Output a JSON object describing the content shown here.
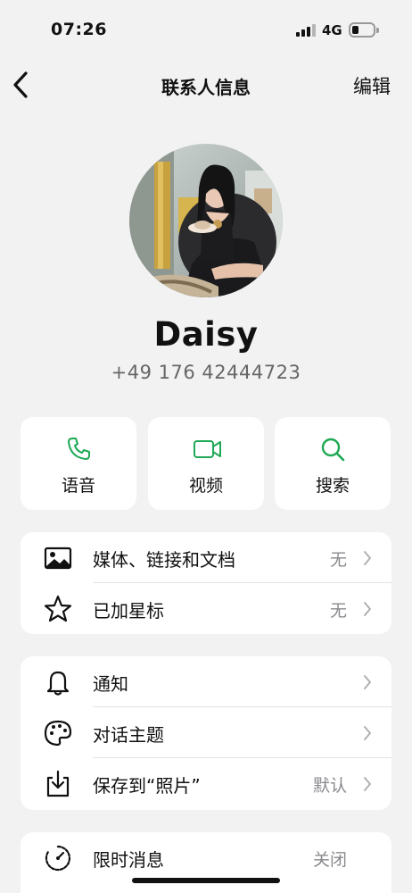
{
  "status_bar": {
    "time": "07:26",
    "network": "4G"
  },
  "nav": {
    "title": "联系人信息",
    "edit_label": "编辑"
  },
  "contact": {
    "name": "Daisy",
    "phone": "+49 176 42444723"
  },
  "actions": [
    {
      "label": "语音",
      "icon": "phone-icon"
    },
    {
      "label": "视频",
      "icon": "video-icon"
    },
    {
      "label": "搜索",
      "icon": "search-icon"
    }
  ],
  "group1": [
    {
      "label": "媒体、链接和文档",
      "value": "无",
      "icon": "image-icon"
    },
    {
      "label": "已加星标",
      "value": "无",
      "icon": "star-icon"
    }
  ],
  "group2": [
    {
      "label": "通知",
      "value": "",
      "icon": "bell-icon"
    },
    {
      "label": "对话主题",
      "value": "",
      "icon": "palette-icon"
    },
    {
      "label": "保存到“照片”",
      "value": "默认",
      "icon": "download-icon"
    }
  ],
  "group3": [
    {
      "label": "限时消息",
      "value": "关闭",
      "icon": "timer-icon"
    }
  ],
  "colors": {
    "accent": "#1fa855",
    "background": "#f2f2f3",
    "card": "#ffffff",
    "secondary_text": "#8a8a8e"
  }
}
